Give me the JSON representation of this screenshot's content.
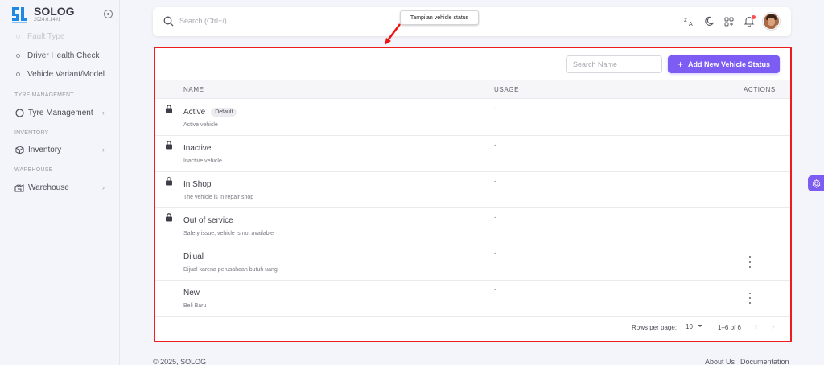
{
  "brand": {
    "name": "SOLOG",
    "version": "2024.6.14#1"
  },
  "sidebar": {
    "faded_item": "Fault Type",
    "sub_items": [
      {
        "label": "Driver Health Check"
      },
      {
        "label": "Vehicle Variant/Model"
      }
    ],
    "sections": [
      {
        "header": "TYRE MANAGEMENT",
        "item": "Tyre Management"
      },
      {
        "header": "INVENTORY",
        "item": "Inventory"
      },
      {
        "header": "WAREHOUSE",
        "item": "Warehouse"
      }
    ]
  },
  "topbar": {
    "search_placeholder": "Search (Ctrl+/)"
  },
  "annotation": {
    "text": "Tampilan vehicle status"
  },
  "toolbar": {
    "search_placeholder": "Search Name",
    "add_label": "Add New Vehicle Status"
  },
  "table": {
    "headers": {
      "name": "NAME",
      "usage": "USAGE",
      "actions": "ACTIONS"
    },
    "rows": [
      {
        "name": "Active",
        "badge": "Default",
        "desc": "Active vehicle",
        "usage": "-"
      },
      {
        "name": "Inactive",
        "desc": "Inactive vehicle",
        "usage": "-"
      },
      {
        "name": "In Shop",
        "desc": "The vehicle is in repair shop",
        "usage": "-"
      },
      {
        "name": "Out of service",
        "desc": "Safety issue, vehicle is not available",
        "usage": "-"
      },
      {
        "name": "Dijual",
        "desc": "Dijual karena perusahaan butuh uang",
        "usage": "-"
      },
      {
        "name": "New",
        "desc": "Beli Baru",
        "usage": "-"
      }
    ]
  },
  "pagination": {
    "rows_per_page_label": "Rows per page:",
    "rows_per_page_value": "10",
    "range": "1–6 of 6"
  },
  "footer": {
    "copyright": "© 2025, SOLOG",
    "about": "About Us",
    "docs": "Documentation"
  },
  "colors": {
    "primary": "#7c5cf2",
    "highlight_border": "#ee1c1c",
    "brand_blue": "#1e88e5"
  }
}
